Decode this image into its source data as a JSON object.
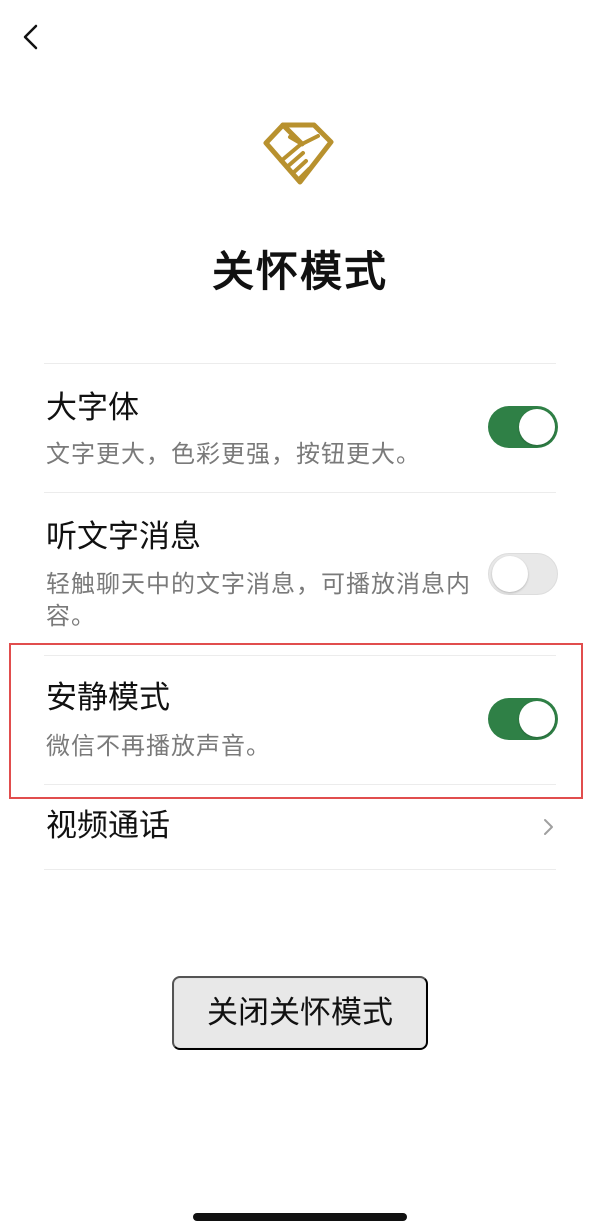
{
  "page": {
    "title": "关怀模式"
  },
  "header": {
    "back_icon": "chevron-left-icon"
  },
  "logo": {
    "icon": "care-heart-hand-icon",
    "accent_color": "#b8912e"
  },
  "settings": [
    {
      "title": "大字体",
      "description": "文字更大，色彩更强，按钮更大。",
      "enabled": true,
      "control": "toggle"
    },
    {
      "title": "听文字消息",
      "description": "轻触聊天中的文字消息，可播放消息内容。",
      "enabled": false,
      "control": "toggle"
    },
    {
      "title": "安静模式",
      "description": "微信不再播放声音。",
      "enabled": true,
      "control": "toggle"
    },
    {
      "title": "视频通话",
      "control": "chevron",
      "icon": "chevron-right-icon"
    }
  ],
  "actions": {
    "close_label": "关闭关怀模式"
  },
  "colors": {
    "toggle_on": "#2f8046",
    "toggle_off": "#e8e8e8",
    "highlight": "#e14d4d"
  }
}
